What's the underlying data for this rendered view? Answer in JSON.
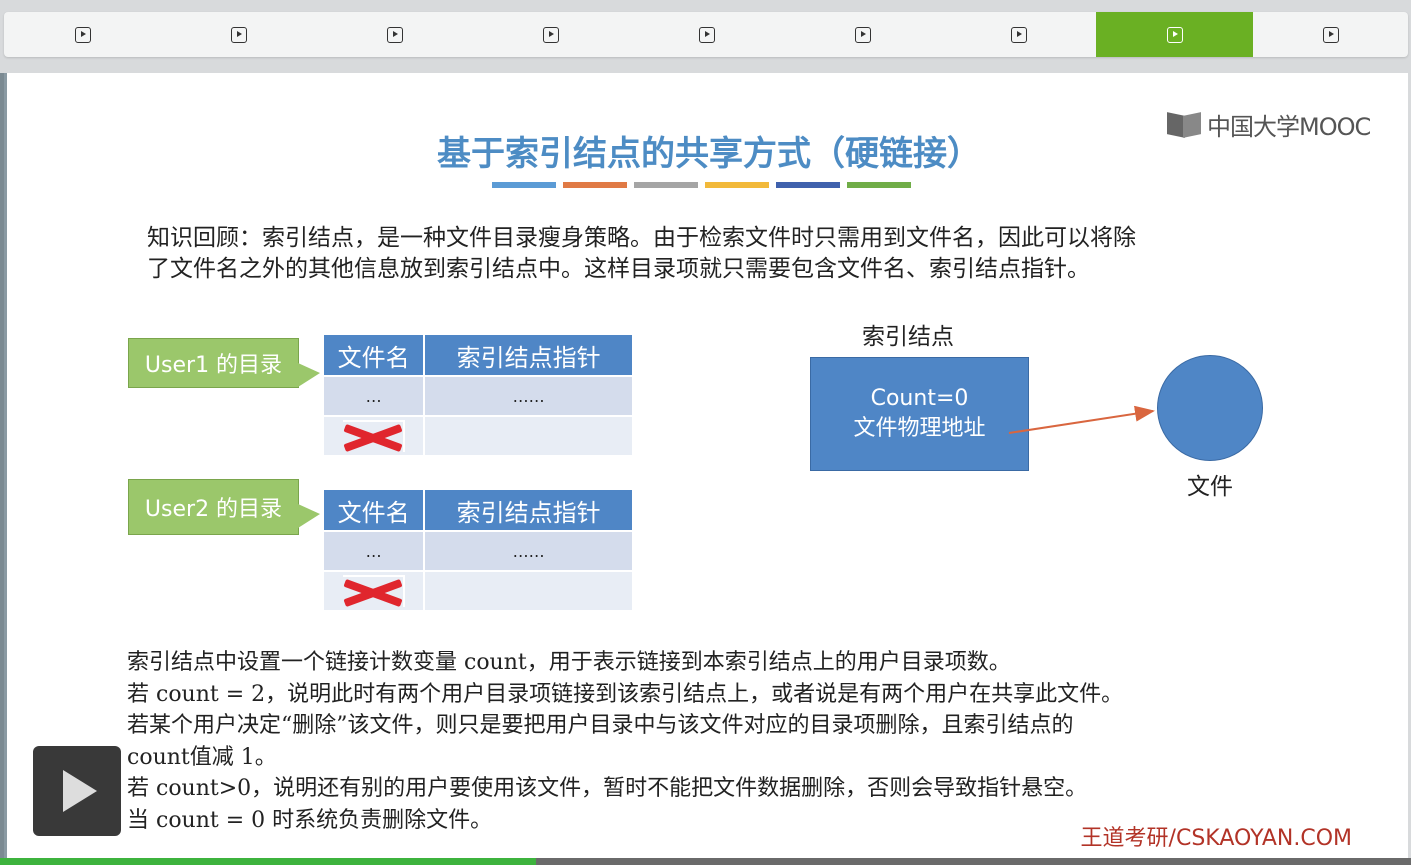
{
  "tabs": [
    {
      "icon": "play-icon",
      "active": false
    },
    {
      "icon": "play-icon",
      "active": false
    },
    {
      "icon": "play-icon",
      "active": false
    },
    {
      "icon": "play-icon",
      "active": false
    },
    {
      "icon": "play-icon",
      "active": false
    },
    {
      "icon": "play-icon",
      "active": false
    },
    {
      "icon": "play-icon",
      "active": false
    },
    {
      "icon": "play-icon",
      "active": true
    },
    {
      "icon": "play-icon",
      "active": false
    }
  ],
  "slide": {
    "logo": "中国大学MOOC",
    "title": "基于索引结点的共享方式（硬链接）",
    "title_bar_colors": [
      "#5b9bd5",
      "#e07a45",
      "#a5a5a5",
      "#f2b93a",
      "#3f61ad",
      "#70ad47"
    ],
    "intro_line1": "知识回顾：索引结点，是一种文件目录瘦身策略。由于检索文件时只需用到文件名，因此可以将除",
    "intro_line2": "了文件名之外的其他信息放到索引结点中。这样目录项就只需要包含文件名、索引结点指针。",
    "user1_label": "User1 的目录",
    "user2_label": "User2 的目录",
    "table_header_name": "文件名",
    "table_header_ptr": "索引结点指针",
    "row_name_dots": "…",
    "row_ptr_dots": "……",
    "inode_label": "索引结点",
    "inode_count": "Count=0",
    "inode_addr": "文件物理地址",
    "file_label": "文件",
    "notes": [
      "索引结点中设置一个链接计数变量 count，用于表示链接到本索引结点上的用户目录项数。",
      "若 count = 2，说明此时有两个用户目录项链接到该索引结点上，或者说是有两个用户在共享此文件。",
      "若某个用户决定“删除”该文件，则只是要把用户目录中与该文件对应的目录项删除，且索引结点的",
      "count值减 1。",
      "若 count>0，说明还有别的用户要使用该文件，暂时不能把文件数据删除，否则会导致指针悬空。",
      "当 count = 0 时系统负责删除文件。"
    ],
    "brand": "王道考研/CSKAOYAN.COM"
  },
  "colors": {
    "active_tab": "#6ab023",
    "accent_blue": "#4f86c6",
    "callout_green": "#9bc76b",
    "delete_red": "#e0262d",
    "arrow": "#d9663f"
  },
  "player": {
    "progress": 0.38
  }
}
